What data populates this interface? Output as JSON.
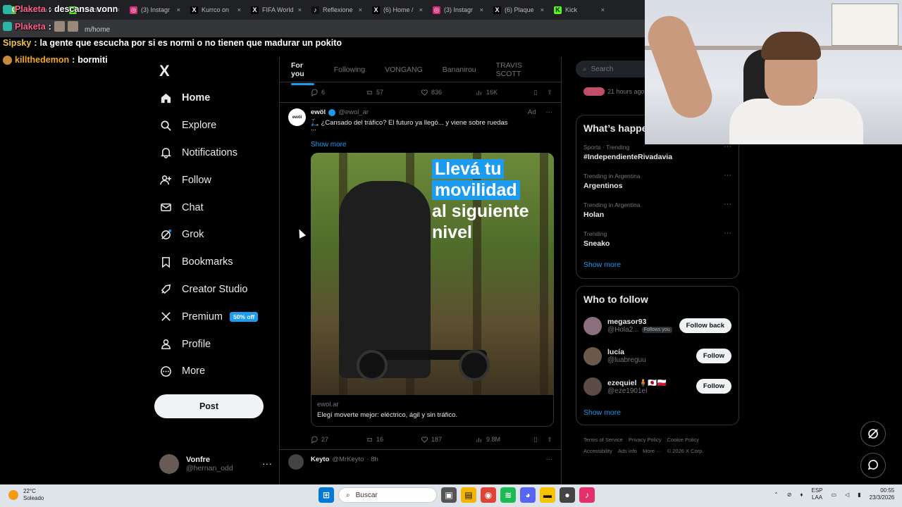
{
  "browser": {
    "tabs": [
      {
        "label": "descansa vonn",
        "icon_color": "#6cc04a",
        "icon": "K"
      },
      {
        "label": "ffranchota",
        "icon_color": "#53fc18",
        "icon": "K"
      },
      {
        "label": "(3) Instagr",
        "icon_color": "#d62976",
        "icon": "◎"
      },
      {
        "label": "Kurrco on",
        "icon_color": "#000000",
        "icon": "X"
      },
      {
        "label": "FIFA World",
        "icon_color": "#000000",
        "icon": "X"
      },
      {
        "label": "Reflexione",
        "icon_color": "#111111",
        "icon": "♪"
      },
      {
        "label": "(6) Home /",
        "icon_color": "#000000",
        "icon": "X"
      },
      {
        "label": "(3) Instagr",
        "icon_color": "#d62976",
        "icon": "◎"
      },
      {
        "label": "(6) Plaque",
        "icon_color": "#000000",
        "icon": "X"
      },
      {
        "label": "Kick",
        "icon_color": "#53fc18",
        "icon": "K"
      }
    ],
    "url": "m/home"
  },
  "chat": [
    {
      "user": "Plaketa",
      "color": "#ff5f8f",
      "message": "descansa vonn"
    },
    {
      "user": "Plaketa",
      "color": "#ff5f8f",
      "message": ""
    },
    {
      "user": "Sipsky",
      "color": "#f5c242",
      "message": "la gente que escucha por si es normi o no tienen que madurar un pokito"
    },
    {
      "user": "killthedemon",
      "color": "#f5a623",
      "message": "bormiti"
    }
  ],
  "nav": {
    "logo": "X",
    "items": [
      {
        "label": "Home",
        "icon": "home-icon"
      },
      {
        "label": "Explore",
        "icon": "search-icon"
      },
      {
        "label": "Notifications",
        "icon": "bell-icon"
      },
      {
        "label": "Follow",
        "icon": "person-add-icon"
      },
      {
        "label": "Chat",
        "icon": "mail-icon"
      },
      {
        "label": "Grok",
        "icon": "grok-icon"
      },
      {
        "label": "Bookmarks",
        "icon": "bookmark-icon"
      },
      {
        "label": "Creator Studio",
        "icon": "rocket-icon"
      },
      {
        "label": "Premium",
        "icon": "x-icon",
        "badge": "50% off"
      },
      {
        "label": "Profile",
        "icon": "person-icon"
      },
      {
        "label": "More",
        "icon": "more-circle-icon"
      }
    ],
    "post_button": "Post",
    "account": {
      "name": "Vonfre",
      "handle": "@hernan_odd"
    }
  },
  "feed": {
    "tabs": [
      "For you",
      "Following",
      "VONGANG",
      "Bananirou",
      "TRAVIS SCOTT"
    ],
    "active_tab": "For you",
    "prev_tweet_actions": {
      "replies": "6",
      "reposts": "57",
      "likes": "836",
      "views": "16K"
    },
    "ad_tweet": {
      "name": "ewöl",
      "handle": "@ewol_ar",
      "ad_label": "Ad",
      "avatar_text": "ewöl",
      "text": "🛴 ¿Cansado del tráfico? El futuro ya llegó... y viene sobre ruedas",
      "ellipsis": "...",
      "show_more": "Show more",
      "media_headline": [
        "Llevá tu",
        "movilidad",
        "al siguiente",
        "nivel"
      ],
      "card_domain": "ewol.ar",
      "card_desc": "Elegí moverte mejor: eléctrico, ágil y sin tráfico.",
      "actions": {
        "replies": "27",
        "reposts": "16",
        "likes": "187",
        "views": "9.8M"
      }
    },
    "next_tweet": {
      "name": "Keyto",
      "handle": "@MrKeyto",
      "time": "· 8h"
    }
  },
  "right": {
    "search_placeholder": "Search",
    "live": {
      "time": "21 hours ago"
    },
    "whats_happening": {
      "title": "What’s happe",
      "trends": [
        {
          "context": "Sports · Trending",
          "topic": "#IndependienteRivadavia"
        },
        {
          "context": "Trending in Argentina",
          "topic": "Argentinos"
        },
        {
          "context": "Trending in Argentina",
          "topic": "Holan"
        },
        {
          "context": "Trending",
          "topic": "Sneako"
        }
      ],
      "show_more": "Show more"
    },
    "who_to_follow": {
      "title": "Who to follow",
      "users": [
        {
          "name": "megasor93",
          "handle": "@Hola2...",
          "follows_you": "Follows you",
          "button": "Follow back",
          "avatar_color": "#8a6f7e"
        },
        {
          "name": "lucía",
          "handle": "@luabreguu",
          "follows_you": "",
          "button": "Follow",
          "avatar_color": "#6b5a4c"
        },
        {
          "name": "ezequiel 🧍🇯🇵🇵🇱",
          "handle": "@eze1901el",
          "follows_you": "",
          "button": "Follow",
          "avatar_color": "#5c4a44"
        }
      ],
      "show_more": "Show more"
    },
    "footer": [
      "Terms of Service",
      "Privacy Policy",
      "Cookie Policy",
      "Accessibility",
      "Ads info",
      "More ···",
      "© 2026 X Corp."
    ]
  },
  "taskbar": {
    "weather_temp": "22°C",
    "weather_desc": "Soleado",
    "search_label": "Buscar",
    "lang_top": "ESP",
    "lang_bottom": "LAA",
    "time": "00:55",
    "date": "23/3/2026"
  }
}
